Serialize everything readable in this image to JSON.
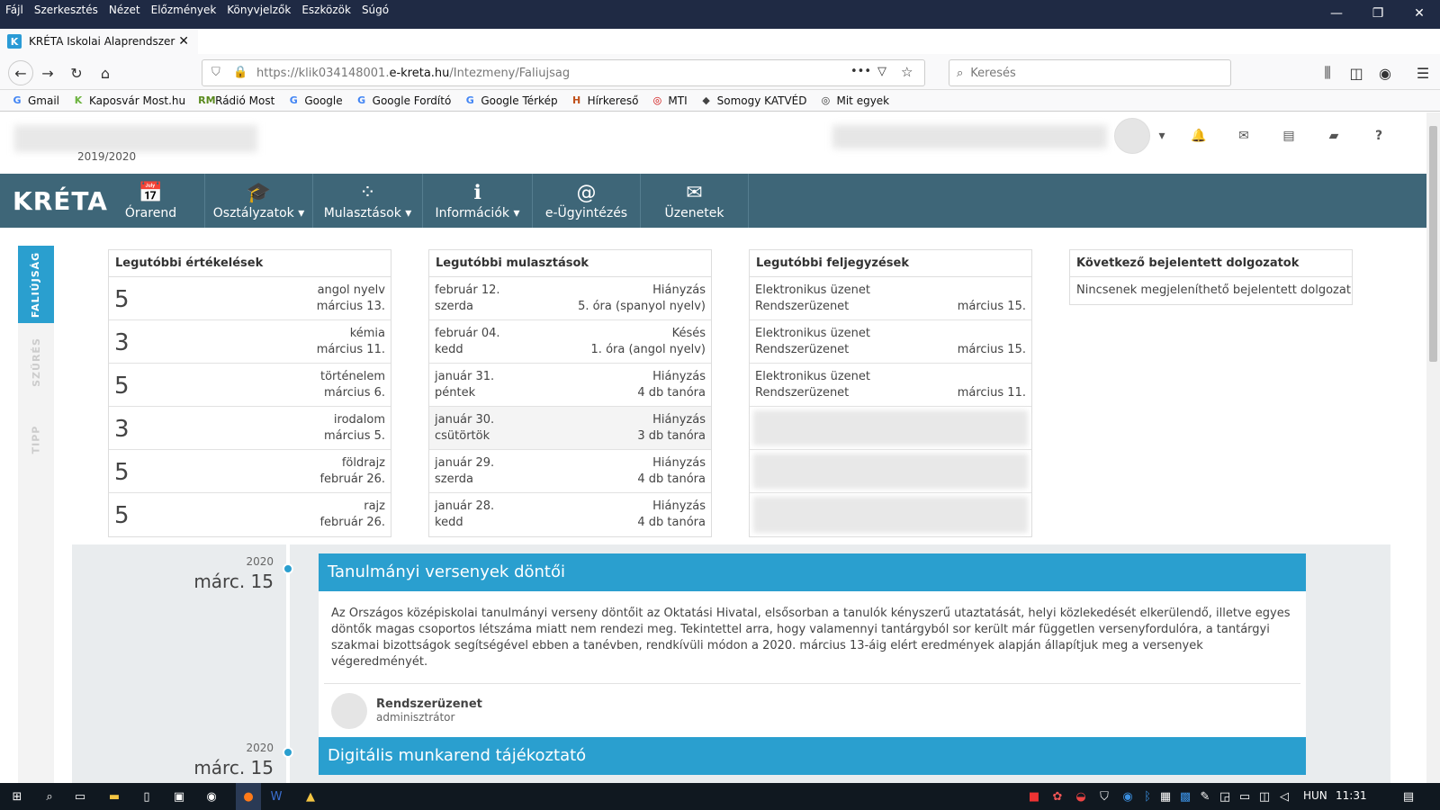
{
  "browser": {
    "menu": [
      "Fájl",
      "Szerkesztés",
      "Nézet",
      "Előzmények",
      "Könyvjelzők",
      "Eszközök",
      "Súgó"
    ],
    "tab_title": "KRÉTA Iskolai Alaprendszer",
    "tab_close": "✕",
    "new_tab": "+",
    "url_prefix": "https://klik034148001.",
    "url_domain": "e-kreta.hu",
    "url_path": "/Intezmeny/Faliujsag",
    "search_placeholder": "Keresés",
    "bookmarks": [
      {
        "label": "Gmail",
        "icon": "G",
        "color": "#4285f4"
      },
      {
        "label": "Kaposvár Most.hu",
        "icon": "K",
        "color": "#6cb33f"
      },
      {
        "label": "Rádió Most",
        "icon": "RM",
        "color": "#5a8a1e"
      },
      {
        "label": "Google",
        "icon": "G",
        "color": "#4285f4"
      },
      {
        "label": "Google Fordító",
        "icon": "G",
        "color": "#4285f4"
      },
      {
        "label": "Google Térkép",
        "icon": "G",
        "color": "#4285f4"
      },
      {
        "label": "Hírkereső",
        "icon": "H",
        "color": "#c0501a"
      },
      {
        "label": "MTI",
        "icon": "◎",
        "color": "#c00"
      },
      {
        "label": "Somogy KATVÉD",
        "icon": "◆",
        "color": "#444"
      },
      {
        "label": "Mit egyek",
        "icon": "◎",
        "color": "#333"
      }
    ]
  },
  "header": {
    "school_year": "2019/2020"
  },
  "nav": {
    "brand": "KRÉTA",
    "items": [
      {
        "label": "Órarend",
        "icon": "📅"
      },
      {
        "label": "Osztályzatok ▾",
        "icon": "🎓"
      },
      {
        "label": "Mulasztások ▾",
        "icon": "⁘"
      },
      {
        "label": "Információk ▾",
        "icon": "ℹ"
      },
      {
        "label": "e-Ügyintézés",
        "icon": "@"
      },
      {
        "label": "Üzenetek",
        "icon": "✉"
      }
    ]
  },
  "sidetabs": [
    "FALIÚJSÁG",
    "SZŰRÉS",
    "TIPP"
  ],
  "grades": {
    "title": "Legutóbbi értékelések",
    "rows": [
      {
        "grade": "5",
        "subject": "angol nyelv",
        "date": "március 13."
      },
      {
        "grade": "3",
        "subject": "kémia",
        "date": "március 11."
      },
      {
        "grade": "5",
        "subject": "történelem",
        "date": "március 6."
      },
      {
        "grade": "3",
        "subject": "irodalom",
        "date": "március 5."
      },
      {
        "grade": "5",
        "subject": "földrajz",
        "date": "február 26."
      },
      {
        "grade": "5",
        "subject": "rajz",
        "date": "február 26."
      }
    ]
  },
  "absences": {
    "title": "Legutóbbi mulasztások",
    "rows": [
      {
        "date": "február 12.",
        "day": "szerda",
        "type": "Hiányzás",
        "detail": "5. óra (spanyol nyelv)"
      },
      {
        "date": "február 04.",
        "day": "kedd",
        "type": "Késés",
        "detail": "1. óra (angol nyelv)"
      },
      {
        "date": "január 31.",
        "day": "péntek",
        "type": "Hiányzás",
        "detail": "4 db tanóra"
      },
      {
        "date": "január 30.",
        "day": "csütörtök",
        "type": "Hiányzás",
        "detail": "3 db tanóra"
      },
      {
        "date": "január 29.",
        "day": "szerda",
        "type": "Hiányzás",
        "detail": "4 db tanóra"
      },
      {
        "date": "január 28.",
        "day": "kedd",
        "type": "Hiányzás",
        "detail": "4 db tanóra"
      }
    ]
  },
  "notes": {
    "title": "Legutóbbi feljegyzések",
    "rows": [
      {
        "type": "Elektronikus üzenet",
        "sender": "Rendszerüzenet",
        "date": "március 15."
      },
      {
        "type": "Elektronikus üzenet",
        "sender": "Rendszerüzenet",
        "date": "március 15."
      },
      {
        "type": "Elektronikus üzenet",
        "sender": "Rendszerüzenet",
        "date": "március 11."
      }
    ]
  },
  "tests": {
    "title": "Következő bejelentett dolgozatok",
    "empty": "Nincsenek megjeleníthető bejelentett dolgozat"
  },
  "timeline": [
    {
      "year": "2020",
      "date": "márc. 15",
      "title": "Tanulmányi versenyek döntői",
      "body": "Az Országos középiskolai tanulmányi verseny döntőit az Oktatási Hivatal, elsősorban a tanulók kényszerű utaztatását, helyi közlekedését elkerülendő, illetve egyes döntők magas csoportos létszáma miatt nem rendezi meg. Tekintettel arra, hogy valamennyi tantárgyból sor került már független versenyfordulóra, a tantárgyi szakmai bizottságok segítségével ebben a tanévben, rendkívüli módon a 2020. március 13-áig elért eredmények alapján állapítjuk meg a versenyek végeredményét.",
      "author": "Rendszerüzenet",
      "role": "adminisztrátor"
    },
    {
      "year": "2020",
      "date": "márc. 15",
      "title": "Digitális munkarend tájékoztató"
    }
  ],
  "taskbar": {
    "lang": "HUN",
    "time": "11:31"
  },
  "colors": {
    "nav_bg": "#3e6678",
    "accent": "#2a9fcf",
    "active_tab": "#2a9bd6"
  }
}
